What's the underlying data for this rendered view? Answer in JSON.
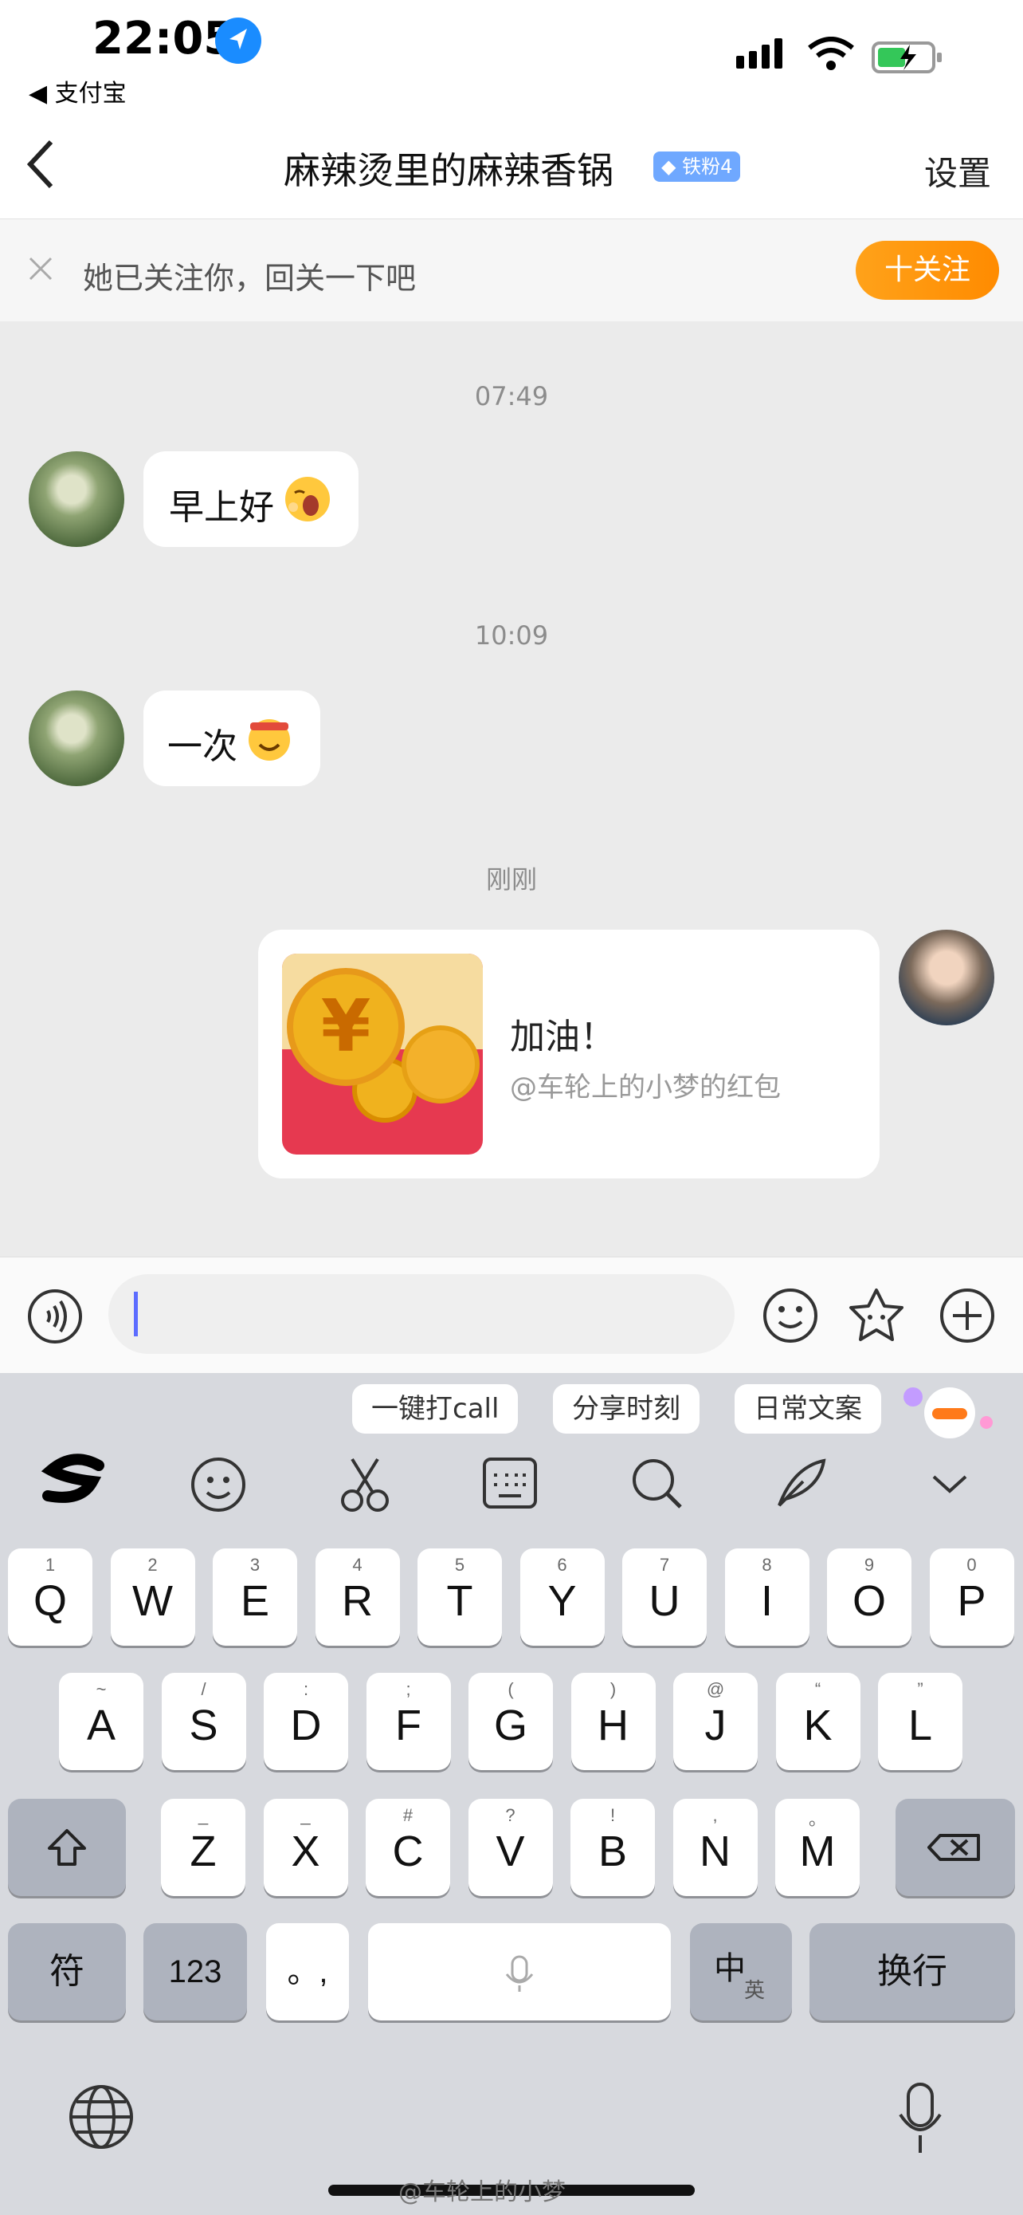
{
  "status_bar": {
    "time": "22:05",
    "back_app": "◀ 支付宝"
  },
  "header": {
    "title": "麻辣烫里的麻辣香锅",
    "badge": "铁粉4",
    "settings": "设置"
  },
  "follow_banner": {
    "text": "她已关注你，回关一下吧",
    "button": "十关注"
  },
  "messages": [
    {
      "time": "07:49",
      "text": "早上好"
    },
    {
      "time": "10:09",
      "text": "一次"
    },
    {
      "time": "刚刚"
    }
  ],
  "red_packet": {
    "title": "加油！",
    "subtitle": "@车轮上的小梦的红包"
  },
  "keyboard": {
    "chips": [
      "一键打call",
      "分享时刻",
      "日常文案"
    ],
    "row1": [
      {
        "m": "Q",
        "h": "1"
      },
      {
        "m": "W",
        "h": "2"
      },
      {
        "m": "E",
        "h": "3"
      },
      {
        "m": "R",
        "h": "4"
      },
      {
        "m": "T",
        "h": "5"
      },
      {
        "m": "Y",
        "h": "6"
      },
      {
        "m": "U",
        "h": "7"
      },
      {
        "m": "I",
        "h": "8"
      },
      {
        "m": "O",
        "h": "9"
      },
      {
        "m": "P",
        "h": "0"
      }
    ],
    "row2": [
      {
        "m": "A",
        "h": "~"
      },
      {
        "m": "S",
        "h": "/"
      },
      {
        "m": "D",
        "h": ":"
      },
      {
        "m": "F",
        "h": ";"
      },
      {
        "m": "G",
        "h": "("
      },
      {
        "m": "H",
        "h": ")"
      },
      {
        "m": "J",
        "h": "@"
      },
      {
        "m": "K",
        "h": "“"
      },
      {
        "m": "L",
        "h": "”"
      }
    ],
    "row3": [
      {
        "m": "Z",
        "h": "_"
      },
      {
        "m": "X",
        "h": "_"
      },
      {
        "m": "C",
        "h": "#"
      },
      {
        "m": "V",
        "h": "?"
      },
      {
        "m": "B",
        "h": "!"
      },
      {
        "m": "N",
        "h": ","
      },
      {
        "m": "M",
        "h": "。"
      }
    ],
    "symbol": "符",
    "num": "123",
    "punct": "。,",
    "lang_main": "中",
    "lang_sub": "英",
    "enter": "换行"
  },
  "watermark": "@车轮上的小梦"
}
